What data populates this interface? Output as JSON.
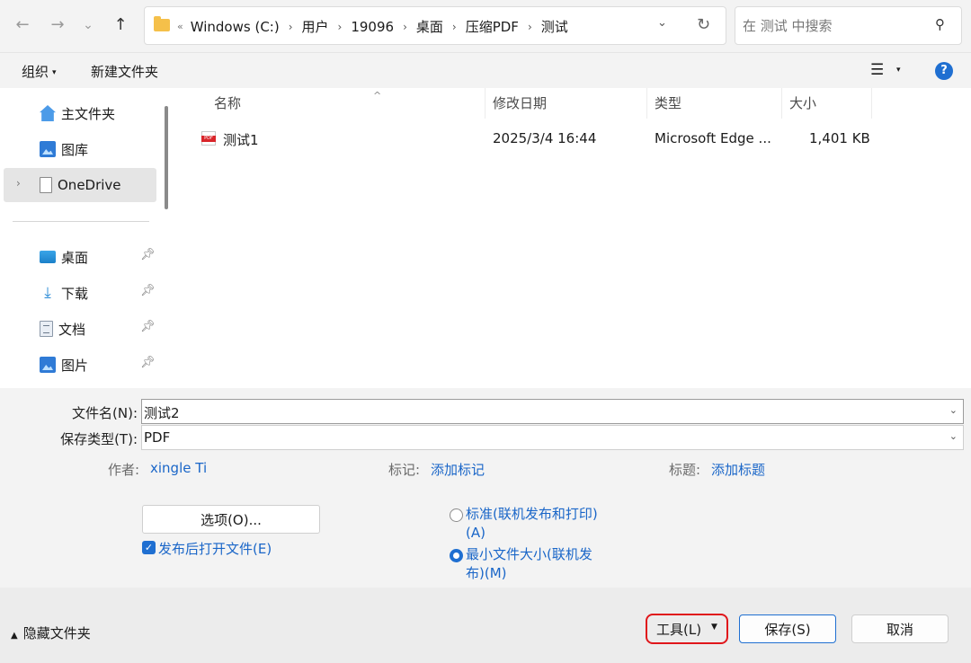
{
  "nav": {
    "back_icon": "←",
    "forward_icon": "→",
    "recent_icon": "⌄",
    "up_icon": "↑"
  },
  "address": {
    "lead": "«",
    "crumbs": [
      "Windows (C:)",
      "用户",
      "19096",
      "桌面",
      "压缩PDF",
      "测试"
    ],
    "separator": "›"
  },
  "search": {
    "placeholder": "在 测试 中搜索"
  },
  "toolbar": {
    "organize": "组织",
    "new_folder": "新建文件夹",
    "help": "?"
  },
  "sidebar": {
    "items": [
      {
        "label": "主文件夹",
        "icon": "home-icon"
      },
      {
        "label": "图库",
        "icon": "gallery-icon"
      },
      {
        "label": "OneDrive",
        "icon": "document-icon"
      },
      {
        "label": "桌面",
        "icon": "desktop-icon"
      },
      {
        "label": "下载",
        "icon": "download-icon"
      },
      {
        "label": "文档",
        "icon": "documents-icon"
      },
      {
        "label": "图片",
        "icon": "pictures-icon"
      }
    ]
  },
  "columns": {
    "name": "名称",
    "date": "修改日期",
    "type": "类型",
    "size": "大小"
  },
  "files": [
    {
      "name": "测试1",
      "date": "2025/3/4 16:44",
      "type": "Microsoft Edge ...",
      "size": "1,401 KB"
    }
  ],
  "form": {
    "filename_label": "文件名(N):",
    "filename_value": "测试2",
    "filetype_label": "保存类型(T):",
    "filetype_value": "PDF",
    "author_label": "作者:",
    "author_value": "xingle Ti",
    "tags_label": "标记:",
    "tags_value": "添加标记",
    "title_label": "标题:",
    "title_value": "添加标题",
    "options_button": "选项(O)...",
    "open_after_publish": "发布后打开文件(E)",
    "open_after_publish_checked": true,
    "radio_standard": "标准(联机发布和打印)(A)",
    "radio_minimum": "最小文件大小(联机发布)(M)",
    "selected_radio": "minimum"
  },
  "footer": {
    "hide_folders": "隐藏文件夹",
    "tools": "工具(L)",
    "save": "保存(S)",
    "cancel": "取消"
  },
  "colors": {
    "accent": "#1f6fd1",
    "link": "#1a66c8",
    "highlight": "#e0161b"
  }
}
